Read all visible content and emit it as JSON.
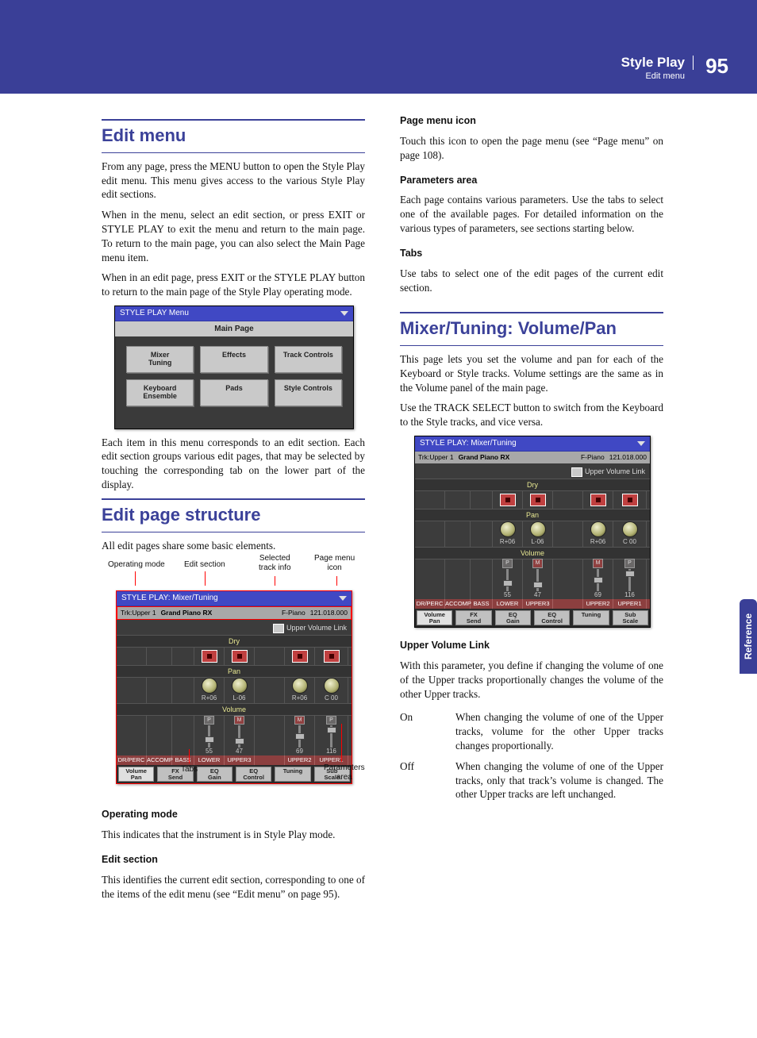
{
  "header": {
    "chapter": "Style Play",
    "subtitle": "Edit menu",
    "page_number": "95"
  },
  "side_tab": "Reference",
  "left": {
    "sec1_title": "Edit menu",
    "p1": "From any page, press the MENU button to open the Style Play edit menu. This menu gives access to the various Style Play edit sections.",
    "p2": "When in the menu, select an edit section, or press EXIT or STYLE PLAY to exit the menu and return to the main page. To return to the main page, you can also select the Main Page menu item.",
    "p3": "When in an edit page, press EXIT or the STYLE PLAY button to return to the main page of the Style Play operating mode.",
    "menu_shot": {
      "title": "STYLE PLAY Menu",
      "main_page": "Main Page",
      "buttons": [
        "Mixer\nTuning",
        "Effects",
        "Track Controls",
        "Keyboard\nEnsemble",
        "Pads",
        "Style Controls"
      ]
    },
    "p4": "Each item in this menu corresponds to an edit section. Each edit section groups various edit pages, that may be selected by touching the corresponding tab on the lower part of the display.",
    "sec2_title": "Edit page structure",
    "p5": "All edit pages share some basic elements.",
    "annot_labels": {
      "op_mode": "Operating mode",
      "edit_section": "Edit section",
      "track_info": "Selected\ntrack info",
      "page_menu_icon": "Page menu\nicon",
      "tabs": "Tabs",
      "params": "Parameters\narea"
    },
    "sub1_title": "Operating mode",
    "sub1_body": "This indicates that the instrument is in Style Play mode.",
    "sub2_title": "Edit section",
    "sub2_body": "This identifies the current edit section, corresponding to one of the items of the edit menu (see “Edit menu” on page 95)."
  },
  "right": {
    "sub3_title": "Page menu icon",
    "sub3_body": "Touch this icon to open the page menu (see “Page menu” on page 108).",
    "sub4_title": "Parameters area",
    "sub4_body": "Each page contains various parameters. Use the tabs to select one of the available pages. For detailed information on the various types of parameters, see sections starting below.",
    "sub5_title": "Tabs",
    "sub5_body": "Use tabs to select one of the edit pages of the current edit section.",
    "sec3_title": "Mixer/Tuning: Volume/Pan",
    "p6": "This page lets you set the volume and pan for each of the Keyboard or Style tracks. Volume settings are the same as in the Volume panel of the main page.",
    "p7": "Use the TRACK SELECT button to switch from the Keyboard to the Style tracks, and vice versa.",
    "mixer_shot": {
      "title": "STYLE PLAY: Mixer/Tuning",
      "trk_label": "Trk:Upper 1",
      "trk_name": "Grand Piano RX",
      "sound": "F-Piano",
      "bank": "121.018.000",
      "uvl_label": "Upper Volume Link",
      "sec_dry": "Dry",
      "sec_pan": "Pan",
      "sec_vol": "Volume",
      "pan_vals": [
        "",
        "",
        "",
        "R+06",
        "L-06",
        "R+06",
        "C 00"
      ],
      "vol_vals": [
        "",
        "",
        "",
        "55",
        "47",
        "69",
        "116"
      ],
      "badges": [
        "",
        "",
        "",
        "P",
        "M",
        "M",
        "P"
      ],
      "chan_labels": [
        "DR/PERC",
        "ACCOMP",
        "BASS",
        "LOWER",
        "UPPER3",
        "UPPER2",
        "UPPER1"
      ],
      "tabs": [
        "Volume\nPan",
        "FX\nSend",
        "EQ\nGain",
        "EQ\nControl",
        "Tuning",
        "Sub\nScale"
      ]
    },
    "sub6_title": "Upper Volume Link",
    "sub6_body": "With this parameter, you define if changing the volume of one of the Upper tracks proportionally changes the volume of the other Upper tracks.",
    "def_on_term": "On",
    "def_on_body": "When changing the volume of one of the Upper tracks, volume for the other Upper tracks changes proportionally.",
    "def_off_term": "Off",
    "def_off_body": "When changing the volume of one of the Upper tracks, only that track’s volume is changed. The other Upper tracks are left unchanged."
  }
}
